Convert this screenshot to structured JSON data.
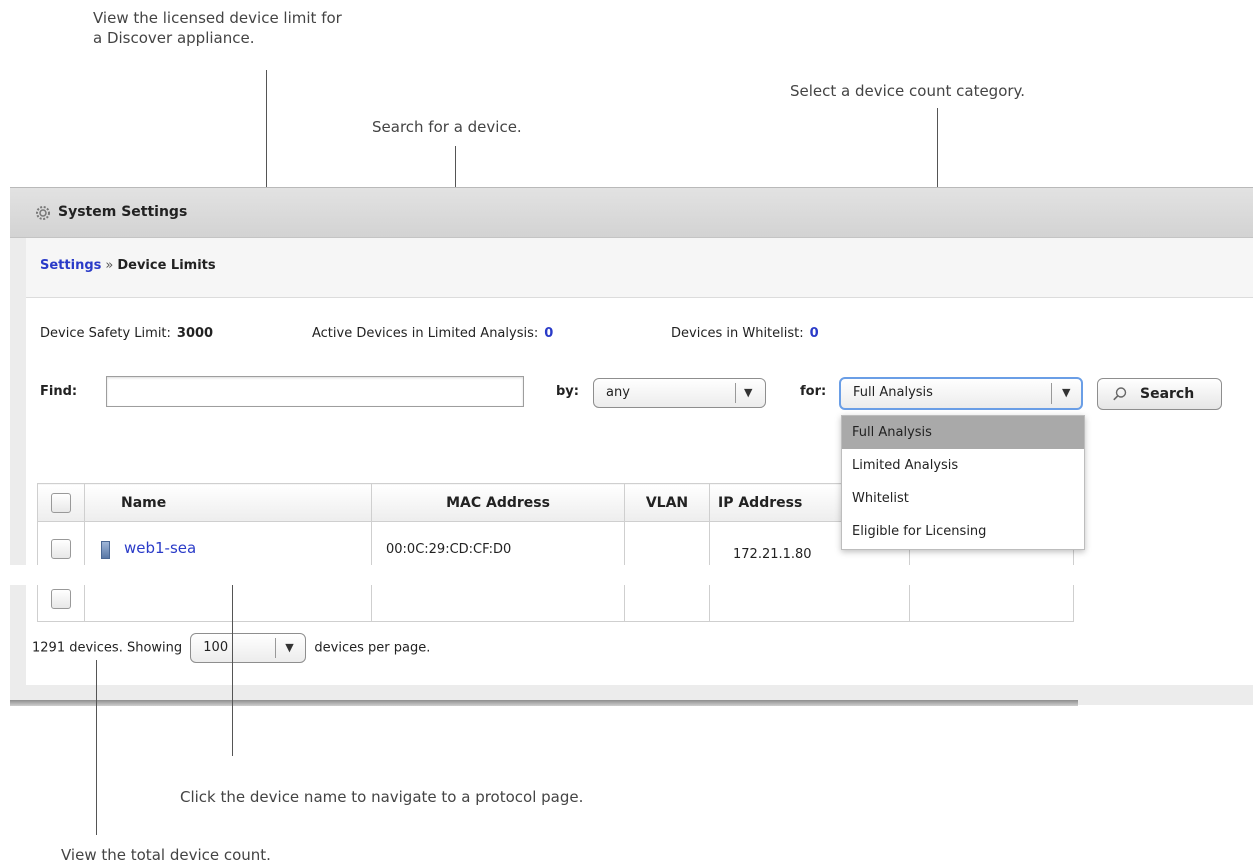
{
  "annotations": {
    "licensed_limit": "View the licensed device limit for\na Discover appliance.",
    "search": "Search for a device.",
    "category": "Select a device count category.",
    "device_name": "Click the device name to navigate to a protocol page.",
    "total_count": "View the total device count."
  },
  "window": {
    "title": "System Settings"
  },
  "breadcrumb": {
    "root": "Settings",
    "separator": "»",
    "current": "Device Limits"
  },
  "stats": {
    "safety_limit_label": "Device Safety Limit:",
    "safety_limit_value": "3000",
    "limited_label": "Active Devices in Limited Analysis:",
    "limited_value": "0",
    "whitelist_label": "Devices in Whitelist:",
    "whitelist_value": "0"
  },
  "search": {
    "find_label": "Find:",
    "find_value": "",
    "by_label": "by:",
    "by_value": "any",
    "for_label": "for:",
    "for_value": "Full Analysis",
    "button_label": "Search"
  },
  "category_menu": {
    "options": [
      "Full Analysis",
      "Limited Analysis",
      "Whitelist",
      "Eligible for Licensing"
    ],
    "selected": "Full Analysis"
  },
  "table": {
    "columns": [
      "",
      "Name",
      "MAC Address",
      "VLAN",
      "IP Address"
    ],
    "rows": [
      {
        "name": "web1-sea",
        "mac": "00:0C:29:CD:CF:D0",
        "vlan": "",
        "ip": "172.21.1.80"
      }
    ]
  },
  "footer": {
    "count_text": "1291 devices. Showing",
    "per_page_value": "100",
    "per_page_suffix": "devices per page."
  },
  "colors": {
    "link": "#2a3bc8",
    "panel": "#ececec"
  }
}
